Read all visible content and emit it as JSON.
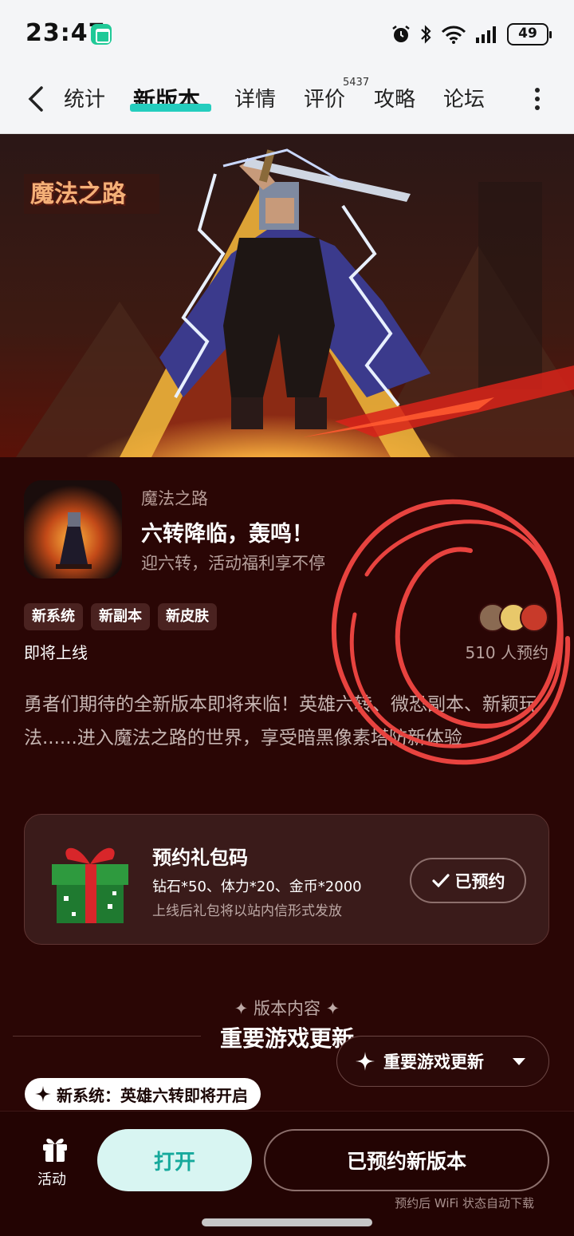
{
  "status_bar": {
    "time": "23:47",
    "battery": "49"
  },
  "nav": {
    "tabs": [
      {
        "label": "统计"
      },
      {
        "label": "新版本"
      },
      {
        "label": "详情"
      },
      {
        "label": "评价"
      },
      {
        "label": "攻略"
      },
      {
        "label": "论坛"
      }
    ],
    "review_count": "5437"
  },
  "hero": {
    "logo_text": "魔法之路"
  },
  "game": {
    "name": "魔法之路",
    "headline": "六转降临，轰鸣！",
    "subline": "迎六转，活动福利享不停",
    "tags": [
      "新系统",
      "新副本",
      "新皮肤"
    ],
    "status": "即将上线",
    "reserve_count": "510 人预约"
  },
  "description": "勇者们期待的全新版本即将来临！英雄六转、微恐副本、新颖玩法......进入魔法之路的世界，享受暗黑像素塔防新体验",
  "gift": {
    "title": "预约礼包码",
    "items": "钻石*50、体力*20、金币*2000",
    "note": "上线后礼包将以站内信形式发放",
    "button": "已预约"
  },
  "section": {
    "label": "✦ 版本内容 ✦",
    "title": "重要游戏更新",
    "filter": "重要游戏更新",
    "chip": "新系统：英雄六转即将开启"
  },
  "bottom": {
    "activity": "活动",
    "open": "打开",
    "reserved_version": "已预约新版本",
    "auto_note": "预约后 WiFi 状态自动下载"
  },
  "colors": {
    "accent": "#24cdbe",
    "background": "#2a0605",
    "annotation": "#e8433f"
  }
}
